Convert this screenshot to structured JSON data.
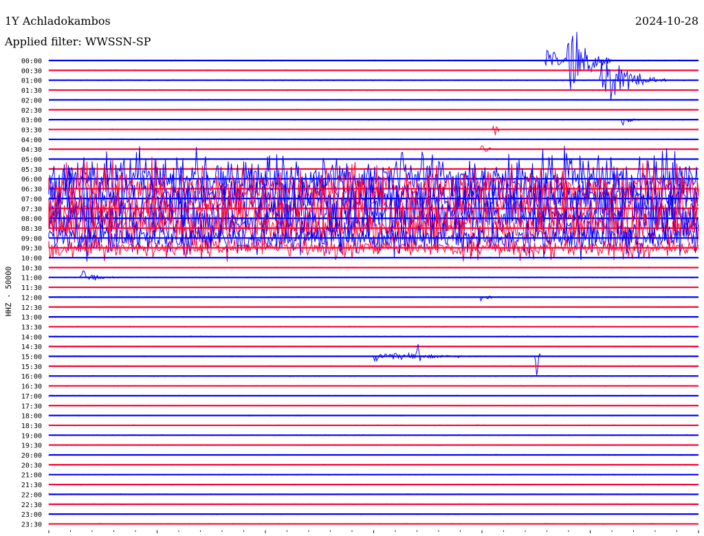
{
  "header": {
    "station": "1Y Achladokambos",
    "filter_label": "Applied filter: WWSSN-SP",
    "date": "2024-10-28"
  },
  "colors": {
    "trace_a": "#0000ff",
    "trace_b": "#ff0033",
    "axis": "#000000"
  },
  "chart_data": {
    "type": "line",
    "title": "1Y Achladokambos",
    "subtitle": "Applied filter: WWSSN-SP",
    "date": "2024-10-28",
    "ylabel": "HHZ - 50000",
    "xlabel": "",
    "row_interval_minutes": 30,
    "row_labels": [
      "00:00",
      "00:30",
      "01:00",
      "01:30",
      "02:00",
      "02:30",
      "03:00",
      "03:30",
      "04:00",
      "04:30",
      "05:00",
      "05:30",
      "06:00",
      "06:30",
      "07:00",
      "07:30",
      "08:00",
      "08:30",
      "09:00",
      "09:30",
      "10:00",
      "10:30",
      "11:00",
      "11:30",
      "12:00",
      "12:30",
      "13:00",
      "13:30",
      "14:00",
      "14:30",
      "15:00",
      "15:30",
      "16:00",
      "16:30",
      "17:00",
      "17:30",
      "18:00",
      "18:30",
      "19:00",
      "19:30",
      "20:00",
      "20:30",
      "21:00",
      "21:30",
      "22:00",
      "22:30",
      "23:00",
      "23:30"
    ],
    "trace_colors": [
      "#0000ff",
      "#ff0033"
    ],
    "grid": false,
    "events": [
      {
        "row": "00:00",
        "minute": 24,
        "amplitude": 5.5,
        "duration_min": 2
      },
      {
        "row": "00:00",
        "minute": 23,
        "amplitude": 1.5,
        "duration_min": 2
      },
      {
        "row": "01:00",
        "minute": 25.5,
        "amplitude": 3.5,
        "duration_min": 3
      },
      {
        "row": "03:00",
        "minute": 26.5,
        "amplitude": 0.8,
        "duration_min": 1
      },
      {
        "row": "03:30",
        "minute": 20.5,
        "amplitude": 1.6,
        "duration_min": 0.3
      },
      {
        "row": "04:30",
        "minute": 20,
        "amplitude": 1.0,
        "duration_min": 0.8
      },
      {
        "row": "06:00",
        "minute": 0,
        "amplitude": 3.5,
        "duration_min": 30,
        "noise": true
      },
      {
        "row": "06:30",
        "minute": 0,
        "amplitude": 3.5,
        "duration_min": 30,
        "noise": true
      },
      {
        "row": "07:00",
        "minute": 0,
        "amplitude": 4.0,
        "duration_min": 30,
        "noise": true
      },
      {
        "row": "07:30",
        "minute": 0,
        "amplitude": 4.0,
        "duration_min": 30,
        "noise": true
      },
      {
        "row": "08:00",
        "minute": 0,
        "amplitude": 4.0,
        "duration_min": 30,
        "noise": true
      },
      {
        "row": "08:30",
        "minute": 0,
        "amplitude": 3.5,
        "duration_min": 30,
        "noise": true
      },
      {
        "row": "09:00",
        "minute": 0,
        "amplitude": 2.5,
        "duration_min": 30,
        "noise": true
      },
      {
        "row": "09:30",
        "minute": 0,
        "amplitude": 1.5,
        "duration_min": 30,
        "noise": true
      },
      {
        "row": "11:00",
        "minute": 1.5,
        "amplitude": 1.3,
        "duration_min": 1.5
      },
      {
        "row": "12:00",
        "minute": 20,
        "amplitude": 0.5,
        "duration_min": 0.8
      },
      {
        "row": "15:00",
        "minute": 15,
        "amplitude": 0.7,
        "duration_min": 7
      },
      {
        "row": "15:00",
        "minute": 17,
        "amplitude": 2.5,
        "duration_min": 0.2
      },
      {
        "row": "15:00",
        "minute": 22.5,
        "amplitude": 3.2,
        "duration_min": 0.2
      }
    ]
  }
}
